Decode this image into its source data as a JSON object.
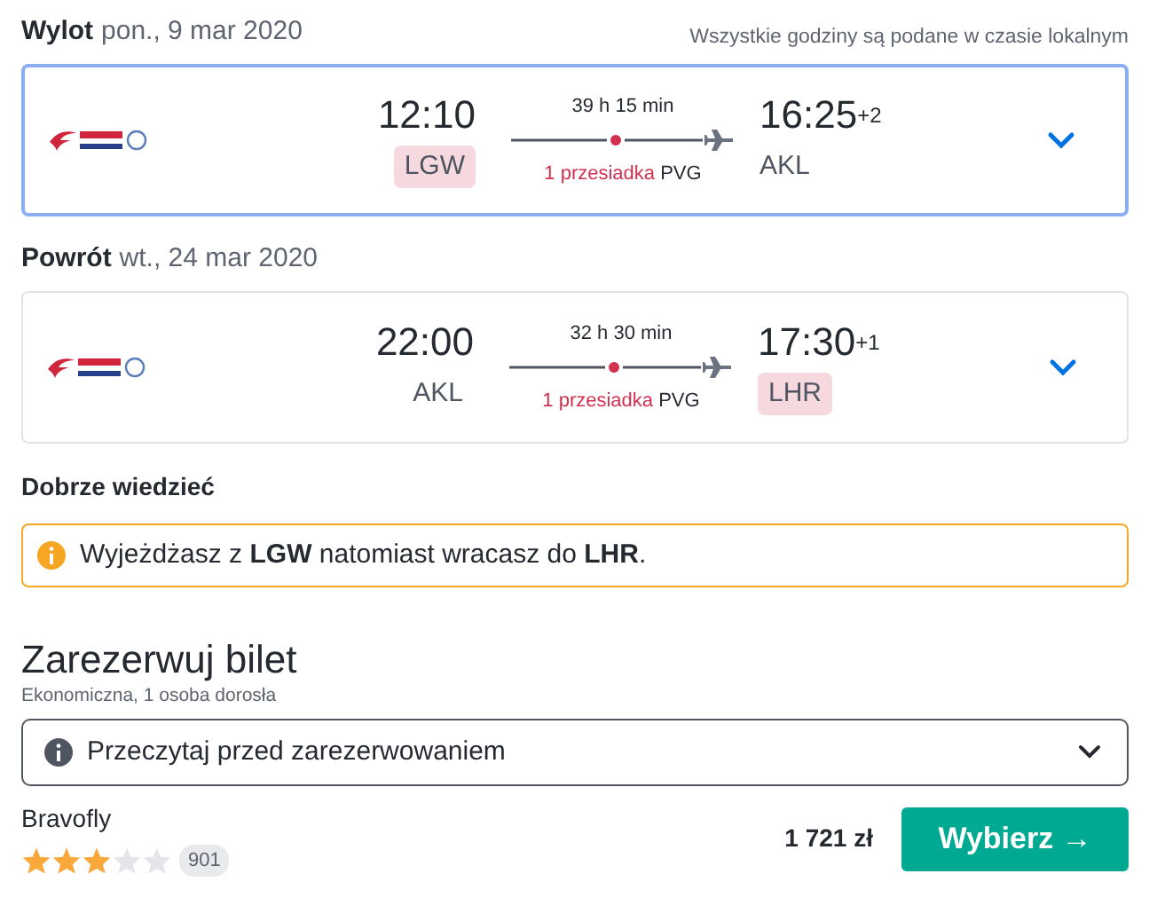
{
  "legs": [
    {
      "label": "Wylot",
      "date": "pon., 9 mar 2020",
      "note": "Wszystkie godziny są podane w czasie lokalnym",
      "selected": true,
      "depart_time": "12:10",
      "depart_airport": "LGW",
      "depart_highlight": true,
      "duration": "39 h 15 min",
      "stops": "1 przesiadka",
      "stop_airport": "PVG",
      "arrive_time": "16:25",
      "day_offset": "+2",
      "arrive_airport": "AKL",
      "arrive_highlight": false
    },
    {
      "label": "Powrót",
      "date": "wt., 24 mar 2020",
      "selected": false,
      "depart_time": "22:00",
      "depart_airport": "AKL",
      "depart_highlight": false,
      "duration": "32 h 30 min",
      "stops": "1 przesiadka",
      "stop_airport": "PVG",
      "arrive_time": "17:30",
      "day_offset": "+1",
      "arrive_airport": "LHR",
      "arrive_highlight": true
    }
  ],
  "good_to_know": {
    "title": "Dobrze wiedzieć",
    "message": "Wyjeżdżasz z **LGW** natomiast wracasz do **LHR**."
  },
  "booking": {
    "title": "Zarezerwuj bilet",
    "subtitle": "Ekonomiczna, 1 osoba dorosła",
    "dropdown": "Przeczytaj przed zarezerwowaniem",
    "provider": "Bravofly",
    "stars": 3,
    "reviews": "901",
    "price": "1 721 zł",
    "button": "Wybierz →"
  }
}
